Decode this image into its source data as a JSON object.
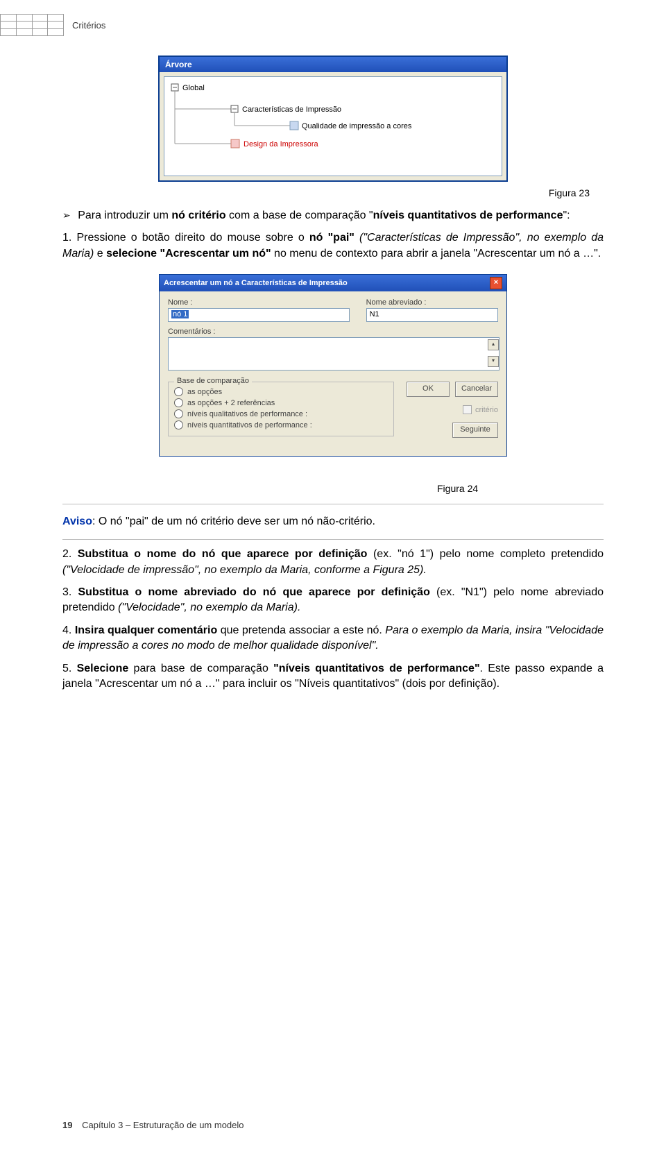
{
  "header": {
    "label": "Critérios"
  },
  "figure23": {
    "caption": "Figura 23",
    "panel_title": "Árvore",
    "nodes": {
      "root": "Global",
      "child1": "Características de Impressão",
      "grandchild1": "Qualidade de impressão a cores",
      "child2_red": "Design da Impressora"
    }
  },
  "intro": {
    "bullet": "➢",
    "text_before_bold": "Para introduzir um ",
    "bold1": "nó critério",
    "text_mid": " com a base de comparação \"",
    "bold2": "níveis quantitativos de performance",
    "text_after": "\":"
  },
  "step1": {
    "num": "1. ",
    "t1": "Pressione o botão direito do mouse sobre o ",
    "b1": "nó \"pai\"",
    "i1": " (\"Características de Impressão\", no exemplo da Maria) ",
    "t2": "e ",
    "b2": "selecione \"Acrescentar um nó\"",
    "t3": " no menu de contexto para abrir a janela \"",
    "t4": "Acrescentar um nó a …\"."
  },
  "dialog": {
    "title": "Acrescentar um nó a Características de Impressão",
    "nome_label": "Nome :",
    "nome_value": "nó 1",
    "abrev_label": "Nome abreviado :",
    "abrev_value": "N1",
    "coment_label": "Comentários :",
    "fieldset_legend": "Base de comparação",
    "radios": [
      "as opções",
      "as opções + 2 referências",
      "níveis qualitativos de performance :",
      "níveis quantitativos de performance :"
    ],
    "criterio_checkbox": "critério",
    "ok_btn": "OK",
    "cancel_btn": "Cancelar",
    "seguinte_btn": "Seguinte"
  },
  "figure24_caption": "Figura 24",
  "aviso": {
    "label": "Aviso",
    "text": ": O nó \"pai\" de um nó critério deve ser um nó não-critério."
  },
  "step2": {
    "num": "2. ",
    "b1": "Substitua o nome do nó que aparece por definição",
    "t1": " (ex. \"nó 1\") pelo nome completo pretendido ",
    "i1": "(\"Velocidade de impressão\", no exemplo da Maria, conforme a Figura 25)."
  },
  "step3": {
    "num": "3. ",
    "b1": "Substitua o nome abreviado do nó que aparece por definição",
    "t1": " (ex. \"N1\") pelo nome abreviado pretendido ",
    "i1": "(\"Velocidade\", no exemplo da Maria)."
  },
  "step4": {
    "num": "4. ",
    "b1": "Insira qualquer comentário",
    "t1": " que pretenda associar a este nó. ",
    "i1": "Para o exemplo da Maria, insira \"Velocidade de impressão a cores no modo de melhor qualidade disponível\"."
  },
  "step5": {
    "num": "5. ",
    "b1": "Selecione",
    "t1": " para base de comparação ",
    "b2": "\"níveis quantitativos de performance\"",
    "t2": ". Este passo expande a janela \"Acrescentar um nó a …\" para incluir os \"Níveis quantitativos\" (dois por definição)."
  },
  "footer": {
    "page": "19",
    "chapter": "Capítulo 3 – Estruturação de um modelo"
  }
}
